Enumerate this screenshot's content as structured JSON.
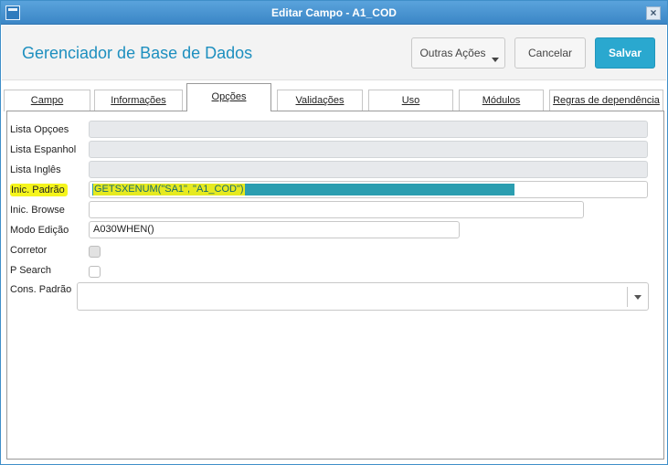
{
  "window": {
    "title": "Editar Campo - A1_COD",
    "close_symbol": "×"
  },
  "header": {
    "title": "Gerenciador de Base de Dados",
    "buttons": {
      "outras_acoes": "Outras Ações",
      "cancelar": "Cancelar",
      "salvar": "Salvar"
    }
  },
  "tabs": [
    {
      "label": "Campo"
    },
    {
      "label": "Informações"
    },
    {
      "label": "Opções"
    },
    {
      "label": "Validações"
    },
    {
      "label": "Uso"
    },
    {
      "label": "Módulos"
    },
    {
      "label": "Regras de dependência"
    }
  ],
  "active_tab": "Opções",
  "form": {
    "lista_opcoes": {
      "label": "Lista Opçoes",
      "value": ""
    },
    "lista_espanhol": {
      "label": "Lista Espanhol",
      "value": ""
    },
    "lista_ingles": {
      "label": "Lista Inglês",
      "value": ""
    },
    "inic_padrao": {
      "label": "Inic. Padrão",
      "value": "GETSXENUM(\"SA1\", \"A1_COD\")"
    },
    "inic_browse": {
      "label": "Inic. Browse",
      "value": ""
    },
    "modo_edicao": {
      "label": "Modo Edição",
      "value": "A030WHEN()"
    },
    "corretor": {
      "label": "Corretor",
      "checked": false
    },
    "p_search": {
      "label": "P Search",
      "checked": false
    },
    "cons_padrao": {
      "label": "Cons. Padrão",
      "value": ""
    }
  },
  "colors": {
    "accent": "#1d8fbf",
    "primary_button": "#2aa8cf",
    "highlight": "#f5f51c",
    "selection": "#2b9eb0"
  },
  "icons": {
    "dropdown": "chevron-down-icon",
    "close": "close-icon",
    "app": "window-app-icon"
  }
}
